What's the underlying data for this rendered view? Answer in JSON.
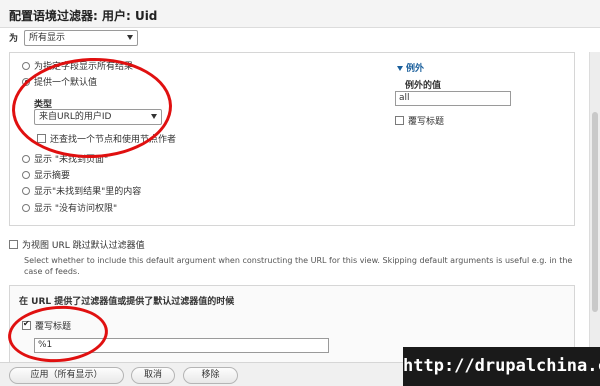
{
  "dialog": {
    "title": "配置语境过滤器: 用户: Uid"
  },
  "for_row": {
    "label": "为",
    "select_value": "所有显示"
  },
  "no_value": {
    "options": [
      "为指定字段显示所有结果",
      "提供一个默认值",
      "显示 \"未找到页面\"",
      "显示摘要",
      "显示\"未找到结果\"里的内容",
      "显示 \"没有访问权限\""
    ],
    "selected_index": 1
  },
  "default_value": {
    "type_label": "类型",
    "type_select": "来自URL的用户ID",
    "also_node_label": "还查找一个节点和使用节点作者"
  },
  "exceptions": {
    "title": "例外",
    "value_label": "例外的值",
    "value": "all",
    "override_label": "覆写标题"
  },
  "skip_default": {
    "label": "为视图 URL 跳过默认过滤器值",
    "description": "Select whether to include this default argument when constructing the URL for this view. Skipping default arguments is useful e.g. in the case of feeds."
  },
  "present": {
    "header": "在 URL 提供了过滤器值或提供了默认过滤器值的时候",
    "override_label": "覆写标题",
    "title_value": "%1"
  },
  "buttons": {
    "apply": "应用（所有显示）",
    "cancel": "取消",
    "remove": "移除"
  },
  "watermark": "http://drupalchina.cn"
}
